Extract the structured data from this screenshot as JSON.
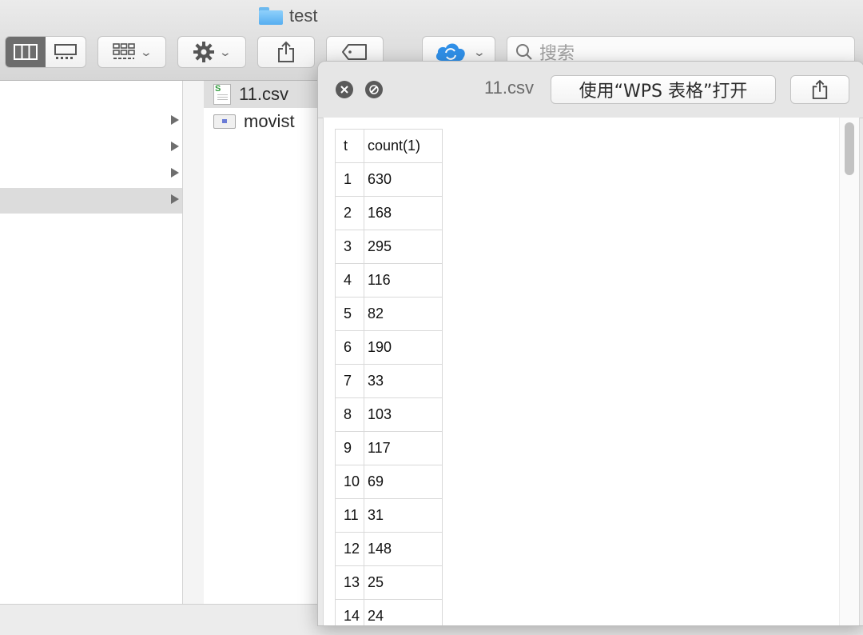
{
  "window": {
    "title": "test"
  },
  "toolbar": {
    "search_placeholder": "搜索"
  },
  "files": [
    {
      "name": "11.csv",
      "type": "csv",
      "selected": true
    },
    {
      "name": "movist",
      "type": "app",
      "selected": false
    }
  ],
  "quicklook": {
    "title": "11.csv",
    "open_button": "使用“WPS 表格”打开"
  },
  "table": {
    "headers": [
      "t",
      "count(1)"
    ],
    "rows": [
      [
        "1",
        "630"
      ],
      [
        "2",
        "168"
      ],
      [
        "3",
        "295"
      ],
      [
        "4",
        "116"
      ],
      [
        "5",
        "82"
      ],
      [
        "6",
        "190"
      ],
      [
        "7",
        "33"
      ],
      [
        "8",
        "103"
      ],
      [
        "9",
        "117"
      ],
      [
        "10",
        "69"
      ],
      [
        "11",
        "31"
      ],
      [
        "12",
        "148"
      ],
      [
        "13",
        "25"
      ],
      [
        "14",
        "24"
      ]
    ]
  }
}
